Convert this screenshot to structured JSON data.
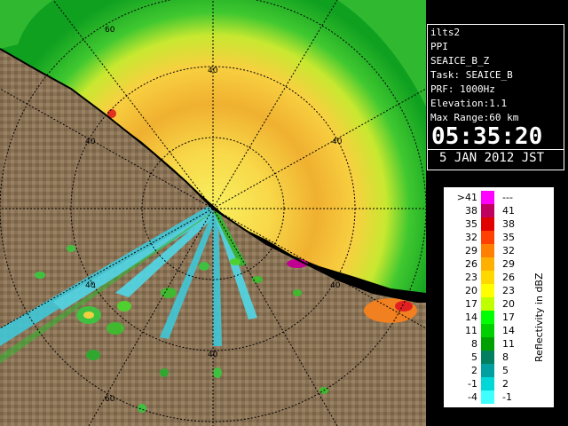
{
  "radar": {
    "range_labels": [
      "60",
      "40",
      "40",
      "40",
      "40",
      "40",
      "60"
    ],
    "colors": {
      "land": "#8a7256",
      "land_dark": "#6b5842",
      "sea": "#000000",
      "echo_high": "#f0a020",
      "echo_mid": "#f8e040",
      "echo_low": "#60d030",
      "echo_edge": "#10b020",
      "cyan": "#50d8e8",
      "magenta": "#c80090"
    }
  },
  "info": {
    "station": "ilts2",
    "scan": "PPI",
    "product": "SEAICE_B_Z",
    "task": "Task: SEAICE_B",
    "prf": "PRF: 1000Hz",
    "elevation": "Elevation:1.1",
    "range": "Max Range:60 km",
    "time": "05:35:20",
    "date": "5 JAN 2012 JST"
  },
  "legend": {
    "title": "Reflectivity in dBZ",
    "rows": [
      {
        "low": ">41",
        "high": "---",
        "color": "#ff00ff"
      },
      {
        "low": "38",
        "high": "41",
        "color": "#c00060"
      },
      {
        "low": "35",
        "high": "38",
        "color": "#e00000"
      },
      {
        "low": "32",
        "high": "35",
        "color": "#ff4000"
      },
      {
        "low": "29",
        "high": "32",
        "color": "#ff8000"
      },
      {
        "low": "26",
        "high": "29",
        "color": "#ffb000"
      },
      {
        "low": "23",
        "high": "26",
        "color": "#ffd800"
      },
      {
        "low": "20",
        "high": "23",
        "color": "#ffff00"
      },
      {
        "low": "17",
        "high": "20",
        "color": "#c0ff00"
      },
      {
        "low": "14",
        "high": "17",
        "color": "#00ff00"
      },
      {
        "low": "11",
        "high": "14",
        "color": "#00d000"
      },
      {
        "low": "8",
        "high": "11",
        "color": "#00a000"
      },
      {
        "low": "5",
        "high": "8",
        "color": "#008060"
      },
      {
        "low": "2",
        "high": "5",
        "color": "#00a0a0"
      },
      {
        "low": "-1",
        "high": "2",
        "color": "#00d8d8"
      },
      {
        "low": "-4",
        "high": "-1",
        "color": "#40ffff"
      }
    ]
  }
}
